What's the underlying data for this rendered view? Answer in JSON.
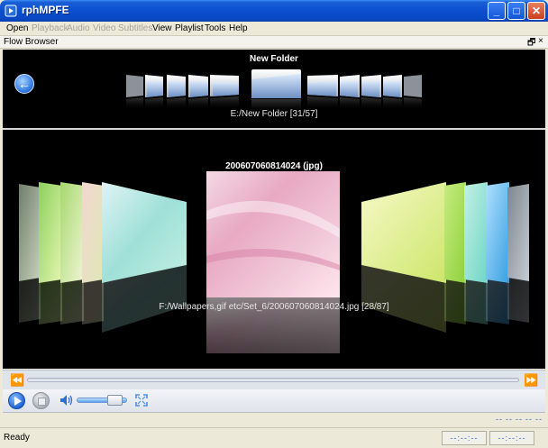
{
  "window": {
    "title": "rphMPFE",
    "minimize": "_",
    "maximize": "□",
    "close": "✕"
  },
  "menu": [
    {
      "label": "Open",
      "enabled": true
    },
    {
      "label": "Playback",
      "enabled": false
    },
    {
      "label": "Audio",
      "enabled": false
    },
    {
      "label": "Video",
      "enabled": false
    },
    {
      "label": "Subtitles",
      "enabled": false
    },
    {
      "label": "View",
      "enabled": true
    },
    {
      "label": "Playlist",
      "enabled": true
    },
    {
      "label": "Tools",
      "enabled": true
    },
    {
      "label": "Help",
      "enabled": true
    }
  ],
  "panel": {
    "title": "Flow Browser",
    "restore": "🗗",
    "close": "×"
  },
  "folder_flow": {
    "title": "New Folder",
    "path": "E:/New Folder [31/57]"
  },
  "image_flow": {
    "title": "200607060814024 (jpg)",
    "path": "F:/Wallpapers,gif etc/Set_6/200607060814024.jpg [28/87]"
  },
  "seek": {
    "rewind": "⏪",
    "forward": "⏩"
  },
  "player": {
    "volume_level": 0.75
  },
  "time_top": [
    "--",
    "--",
    "--",
    "--",
    "--"
  ],
  "status": {
    "text": "Ready",
    "time_a": "--:--:--",
    "time_b": "--:--:--"
  },
  "colors": {
    "titlebar": "#0a4fd0",
    "accent": "#3a66c4",
    "panel_bg": "#000000"
  },
  "icons": [
    "app-icon",
    "back-arrow-icon",
    "folder-icon",
    "volume-icon",
    "fullscreen-icon",
    "play-icon",
    "stop-icon"
  ]
}
